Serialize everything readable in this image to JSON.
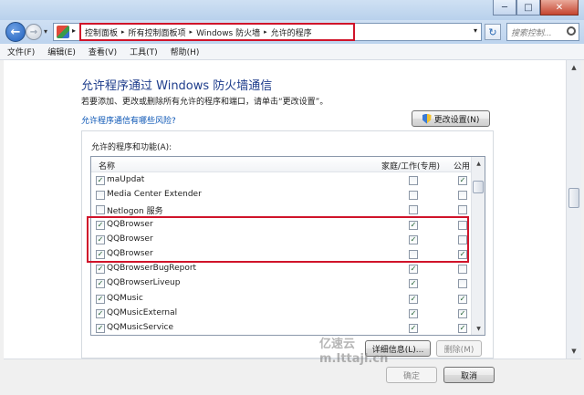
{
  "window": {
    "minimize_glyph": "─",
    "maximize_glyph": "□",
    "close_glyph": "✕"
  },
  "address": {
    "crumbs": [
      "控制面板",
      "所有控制面板项",
      "Windows 防火墙",
      "允许的程序"
    ],
    "search_placeholder": "搜索控制..."
  },
  "menu": [
    "文件(F)",
    "编辑(E)",
    "查看(V)",
    "工具(T)",
    "帮助(H)"
  ],
  "page": {
    "title": "允许程序通过 Windows 防火墙通信",
    "description": "若要添加、更改或删除所有允许的程序和端口，请单击“更改设置”。",
    "risk_link": "允许程序通信有哪些风险?",
    "change_settings": "更改设置(N)",
    "group_label": "允许的程序和功能(A):",
    "columns": {
      "name": "名称",
      "home_work": "家庭/工作(专用)",
      "public": "公用"
    },
    "programs": [
      {
        "name": "maUpdat",
        "enabled": true,
        "home": false,
        "public": true
      },
      {
        "name": "Media Center Extender",
        "enabled": false,
        "home": false,
        "public": false
      },
      {
        "name": "Netlogon 服务",
        "enabled": false,
        "home": false,
        "public": false
      },
      {
        "name": "QQBrowser",
        "enabled": true,
        "home": true,
        "public": false
      },
      {
        "name": "QQBrowser",
        "enabled": true,
        "home": true,
        "public": false
      },
      {
        "name": "QQBrowser",
        "enabled": true,
        "home": false,
        "public": true
      },
      {
        "name": "QQBrowserBugReport",
        "enabled": true,
        "home": true,
        "public": false
      },
      {
        "name": "QQBrowserLiveup",
        "enabled": true,
        "home": true,
        "public": false
      },
      {
        "name": "QQMusic",
        "enabled": true,
        "home": true,
        "public": true
      },
      {
        "name": "QQMusicExternal",
        "enabled": true,
        "home": true,
        "public": true
      },
      {
        "name": "QQMusicService",
        "enabled": true,
        "home": true,
        "public": true
      }
    ],
    "details": "详细信息(L)...",
    "remove": "删除(M)",
    "ok": "确定",
    "cancel": "取消"
  },
  "watermark": {
    "line1": "亿速云",
    "line2": "m.Ittaji.cn"
  },
  "icons": {
    "back": "back-arrow-icon",
    "forward": "forward-arrow-icon",
    "refresh": "refresh-icon",
    "search": "search-icon",
    "shield": "uac-shield-icon",
    "control_panel": "control-panel-icon"
  }
}
